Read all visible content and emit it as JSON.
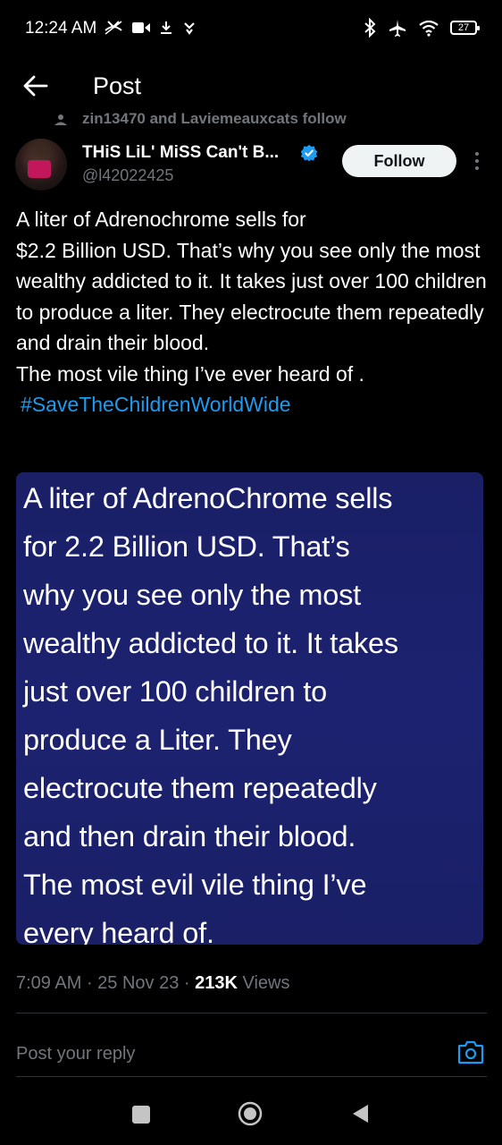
{
  "status_bar": {
    "time": "12:24 AM",
    "battery": "27",
    "left_icons": [
      "missed-call-icon",
      "video-icon",
      "download-icon",
      "notification-icon"
    ],
    "right_icons": [
      "bluetooth-icon",
      "airplane-icon",
      "wifi-icon",
      "battery-icon"
    ]
  },
  "header": {
    "title": "Post"
  },
  "social_context": "zin13470 and Laviemeauxcats follow",
  "author": {
    "display_name": "THiS LiL' MiSS Can't B...",
    "handle": "@l42022425",
    "verified_color": "#1d9bf0"
  },
  "follow_label": "Follow",
  "tweet": {
    "text": "A liter of Adrenochrome sells for\n$2.2 Billion USD. That’s why you see only the most wealthy addicted to it. It takes just over 100 children to produce a liter. They electrocute them repeatedly and drain their blood.\nThe most vile thing I’ve ever heard of .",
    "hashtag": "#SaveTheChildrenWorldWide"
  },
  "media": {
    "text": "A liter of AdrenoChrome sells\nfor 2.2 Billion USD. That’s\nwhy you see only the most\nwealthy addicted to it. It takes\njust over 100 children to\nproduce a Liter. They\nelectrocute them repeatedly\nand then drain their blood.\nThe most evil vile thing I’ve\nevery heard of.",
    "background": "#1b2065"
  },
  "meta": {
    "time": "7:09 AM",
    "date": "25 Nov 23",
    "views_count": "213K",
    "views_label": "Views"
  },
  "reply": {
    "placeholder": "Post your reply"
  },
  "colors": {
    "accent": "#1d9bf0",
    "muted": "#71767b",
    "background": "#000000"
  }
}
